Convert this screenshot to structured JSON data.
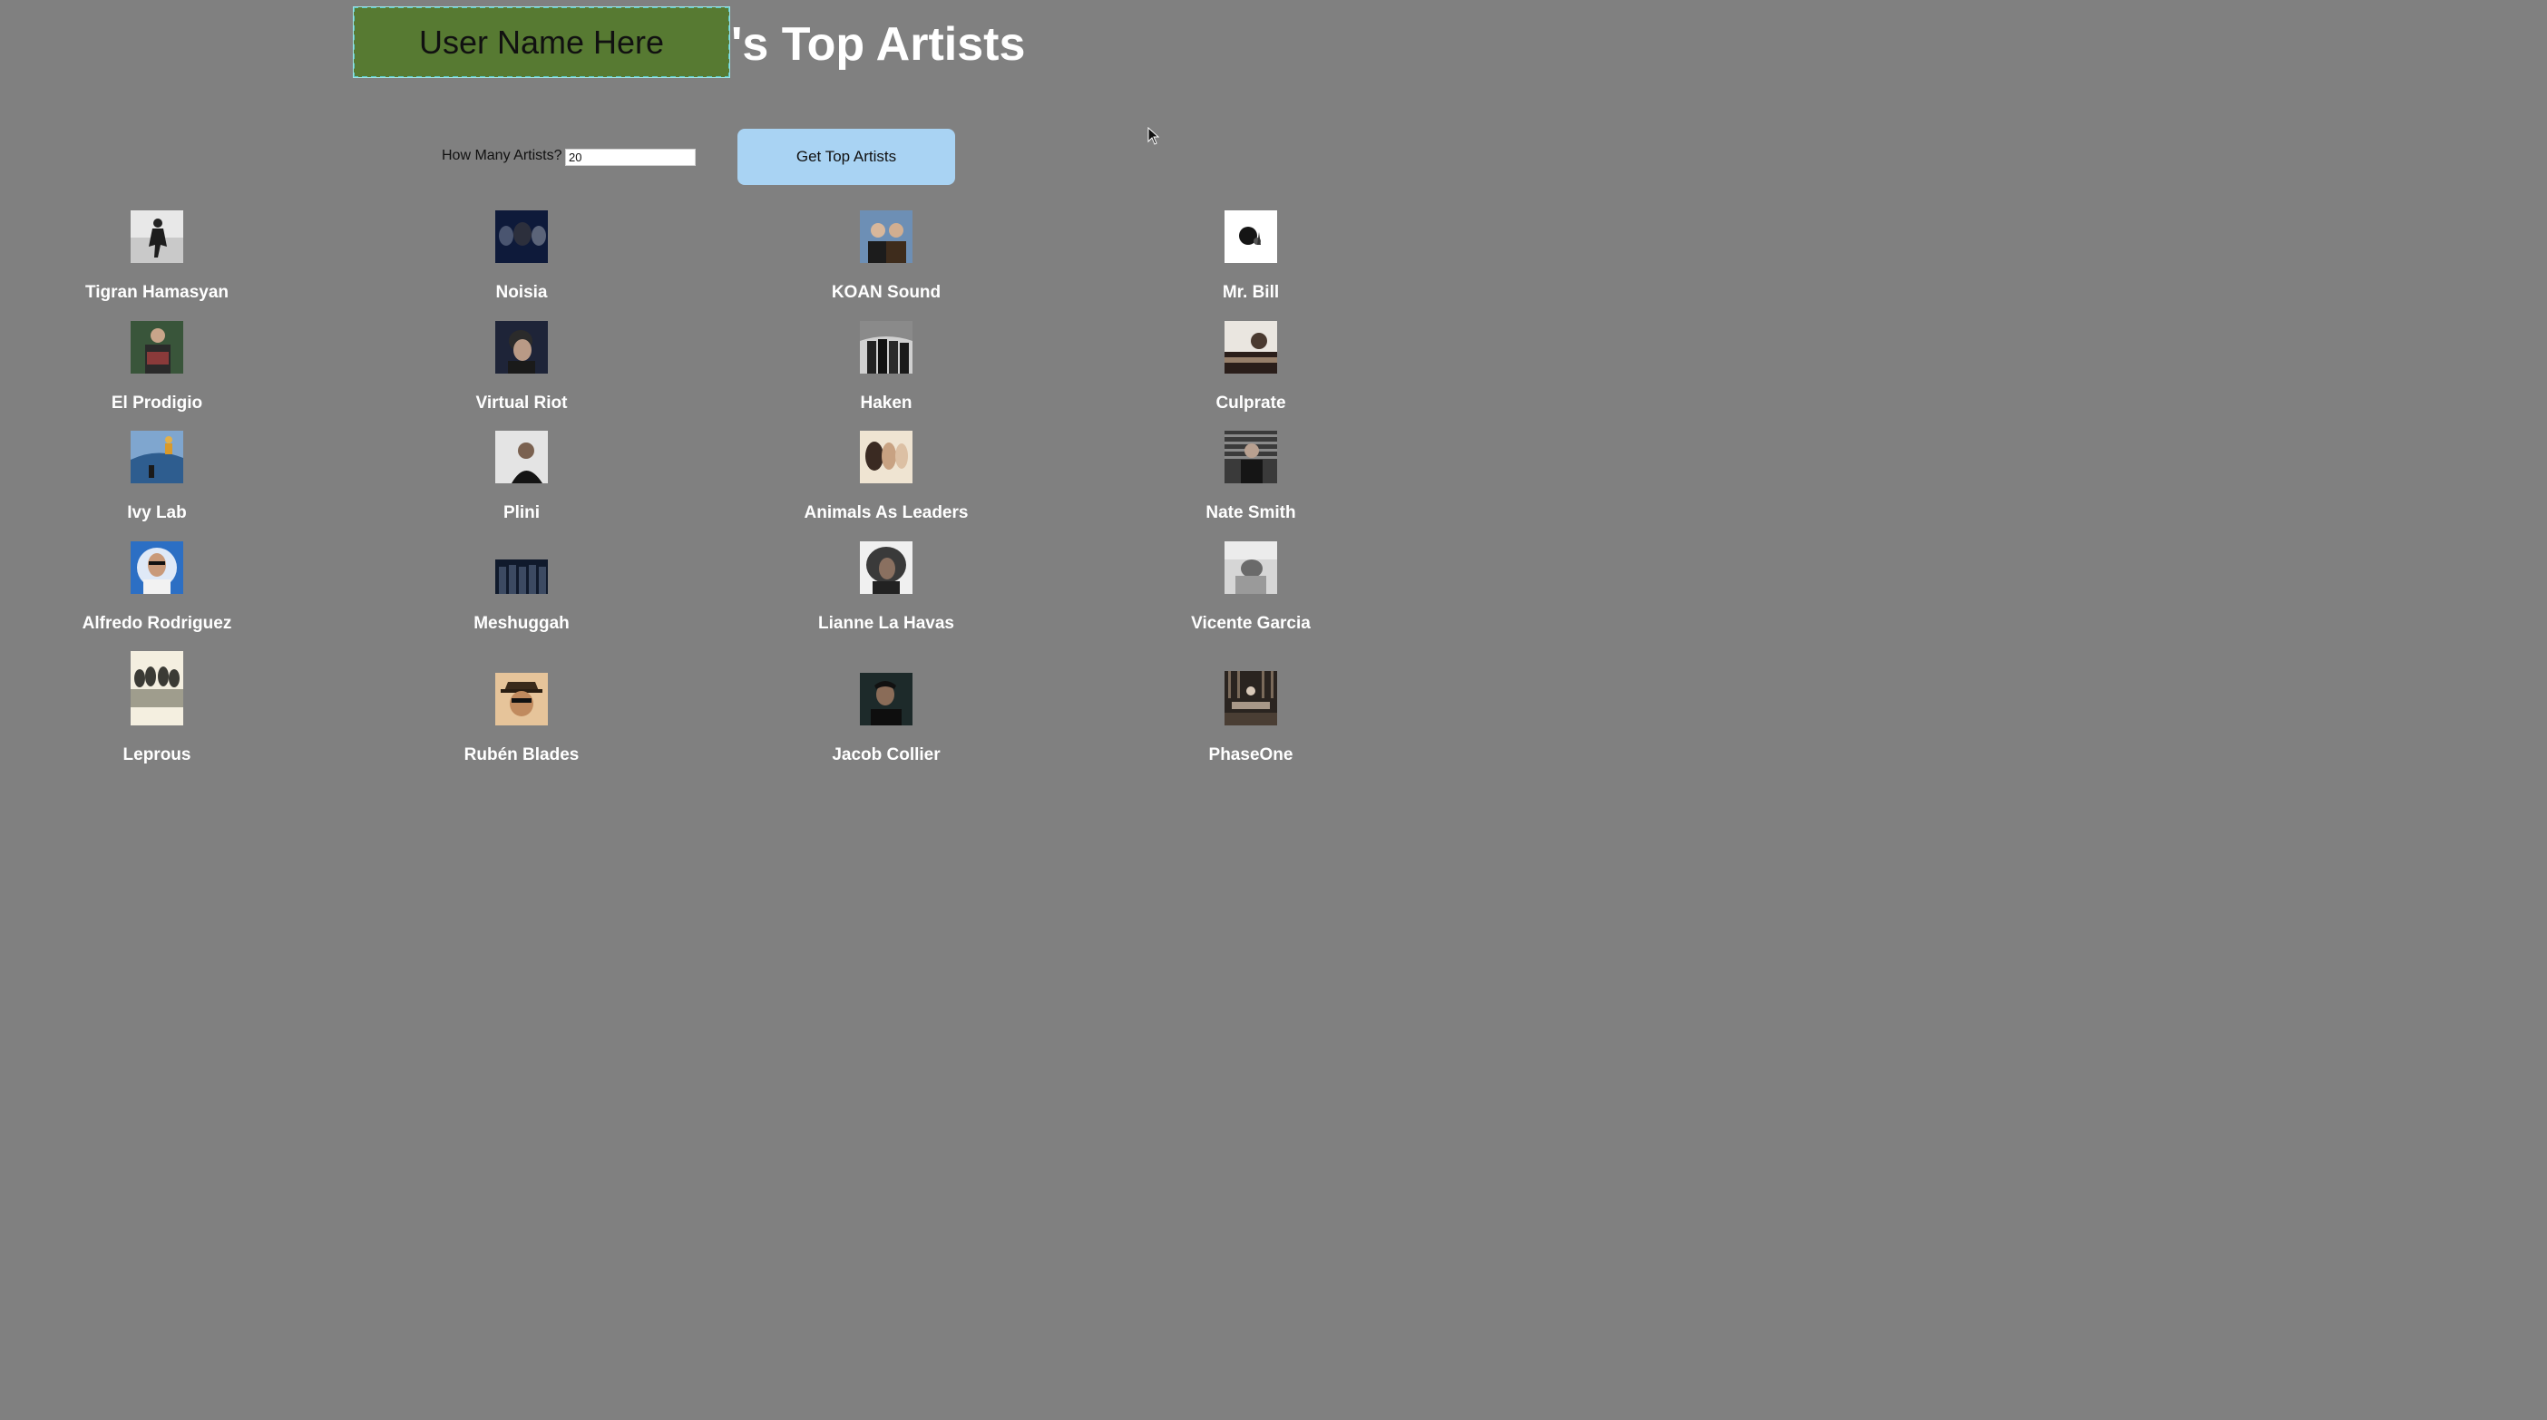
{
  "header": {
    "username": "User Name Here",
    "title_suffix": "'s Top Artists"
  },
  "controls": {
    "count_label": "How Many Artists?",
    "count_value": "20",
    "button_label": "Get Top Artists"
  },
  "artists": [
    {
      "name": "Tigran Hamasyan"
    },
    {
      "name": "Noisia"
    },
    {
      "name": "KOAN Sound"
    },
    {
      "name": "Mr. Bill"
    },
    {
      "name": "El Prodigio"
    },
    {
      "name": "Virtual Riot"
    },
    {
      "name": "Haken"
    },
    {
      "name": "Culprate"
    },
    {
      "name": "Ivy Lab"
    },
    {
      "name": "Plini"
    },
    {
      "name": "Animals As Leaders"
    },
    {
      "name": "Nate Smith"
    },
    {
      "name": "Alfredo Rodriguez"
    },
    {
      "name": "Meshuggah"
    },
    {
      "name": "Lianne La Havas"
    },
    {
      "name": "Vicente Garcia"
    },
    {
      "name": "Leprous"
    },
    {
      "name": "Rubén Blades"
    },
    {
      "name": "Jacob Collier"
    },
    {
      "name": "PhaseOne"
    }
  ],
  "colors": {
    "background": "#808080",
    "username_box": "#577a32",
    "button": "#a9d3f3"
  }
}
